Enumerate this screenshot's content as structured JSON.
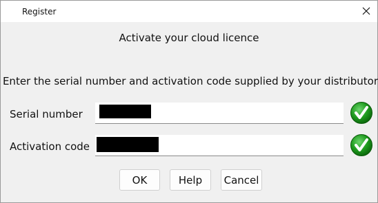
{
  "window": {
    "title": "Register"
  },
  "dialog": {
    "heading": "Activate your cloud licence",
    "instruction": "Enter the serial number and activation code supplied by your distributor"
  },
  "fields": {
    "serial": {
      "label": "Serial number",
      "value": "",
      "status_icon": "green-check-icon"
    },
    "activation": {
      "label": "Activation code",
      "value": "",
      "status_icon": "green-check-icon"
    }
  },
  "buttons": {
    "ok": "OK",
    "help": "Help",
    "cancel": "Cancel"
  },
  "colors": {
    "check_green": "#1e9a1e",
    "redaction": "#000000"
  }
}
